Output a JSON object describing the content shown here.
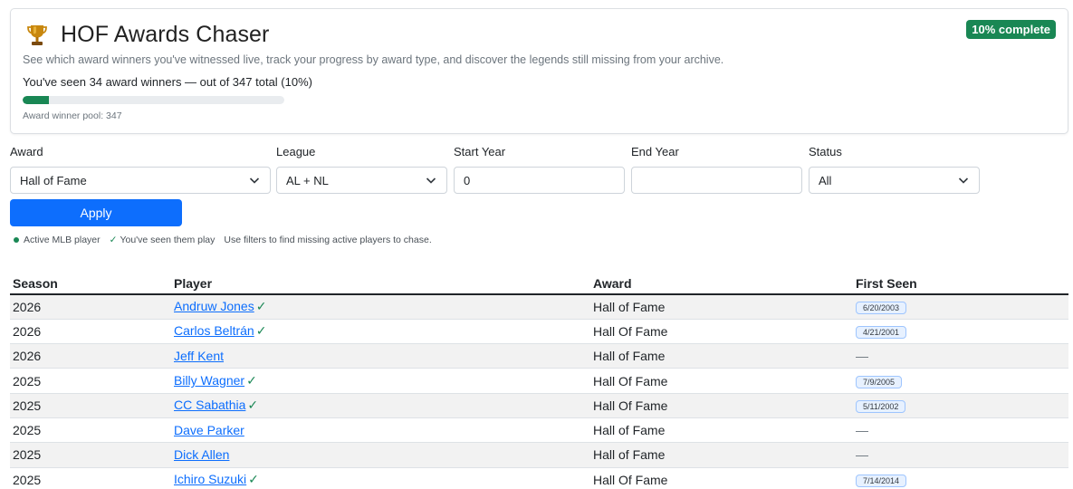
{
  "header": {
    "title": "HOF Awards Chaser",
    "badge": "10% complete",
    "subtitle": "See which award winners you've witnessed live, track your progress by award type, and discover the legends still missing from your archive.",
    "seen_text": "You've seen 34 award winners — out of 347 total (10%)",
    "progress_fraction": 0.1,
    "pool_text": "Award winner pool: 347"
  },
  "filters": {
    "award": {
      "label": "Award",
      "value": "Hall of Fame"
    },
    "league": {
      "label": "League",
      "value": "AL + NL"
    },
    "start_year": {
      "label": "Start Year",
      "value": "0"
    },
    "end_year": {
      "label": "End Year",
      "value": ""
    },
    "status": {
      "label": "Status",
      "value": "All"
    },
    "apply_label": "Apply"
  },
  "legend": {
    "active": "Active MLB player",
    "seen": "You've seen them play",
    "hint": "Use filters to find missing active players to chase."
  },
  "table": {
    "columns": [
      "Season",
      "Player",
      "Award",
      "First Seen"
    ],
    "rows": [
      {
        "season": "2026",
        "player": "Andruw Jones",
        "seen": true,
        "award": "Hall of Fame",
        "first_seen": "6/20/2003"
      },
      {
        "season": "2026",
        "player": "Carlos Beltrán",
        "seen": true,
        "award": "Hall Of Fame",
        "first_seen": "4/21/2001"
      },
      {
        "season": "2026",
        "player": "Jeff Kent",
        "seen": false,
        "award": "Hall of Fame",
        "first_seen": "—"
      },
      {
        "season": "2025",
        "player": "Billy Wagner",
        "seen": true,
        "award": "Hall Of Fame",
        "first_seen": "7/9/2005"
      },
      {
        "season": "2025",
        "player": "CC Sabathia",
        "seen": true,
        "award": "Hall Of Fame",
        "first_seen": "5/11/2002"
      },
      {
        "season": "2025",
        "player": "Dave Parker",
        "seen": false,
        "award": "Hall of Fame",
        "first_seen": "—"
      },
      {
        "season": "2025",
        "player": "Dick Allen",
        "seen": false,
        "award": "Hall of Fame",
        "first_seen": "—"
      },
      {
        "season": "2025",
        "player": "Ichiro Suzuki",
        "seen": true,
        "award": "Hall Of Fame",
        "first_seen": "7/14/2014"
      }
    ]
  },
  "colors": {
    "accent": "#0d6efd",
    "success": "#198754"
  }
}
